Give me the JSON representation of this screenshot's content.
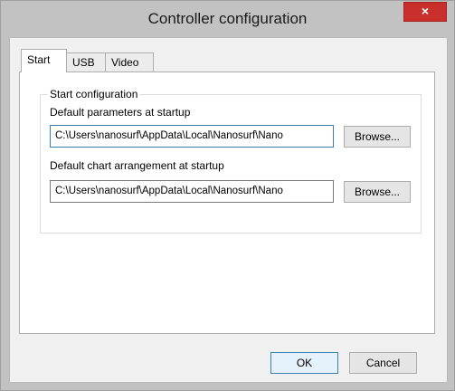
{
  "window": {
    "title": "Controller configuration",
    "close_glyph": "×"
  },
  "tabs": [
    {
      "label": "Start",
      "active": true
    },
    {
      "label": "USB",
      "active": false
    },
    {
      "label": "Video",
      "active": false
    }
  ],
  "start": {
    "group_title": "Start configuration",
    "params_label": "Default parameters at startup",
    "params_value": "C:\\Users\\nanosurf\\AppData\\Local\\Nanosurf\\Nano",
    "chart_label": "Default chart arrangement at startup",
    "chart_value": "C:\\Users\\nanosurf\\AppData\\Local\\Nanosurf\\Nano",
    "browse_label": "Browse..."
  },
  "footer": {
    "ok_label": "OK",
    "cancel_label": "Cancel"
  },
  "colors": {
    "close_button": "#c9302c",
    "focus_border": "#3c7fb1"
  }
}
